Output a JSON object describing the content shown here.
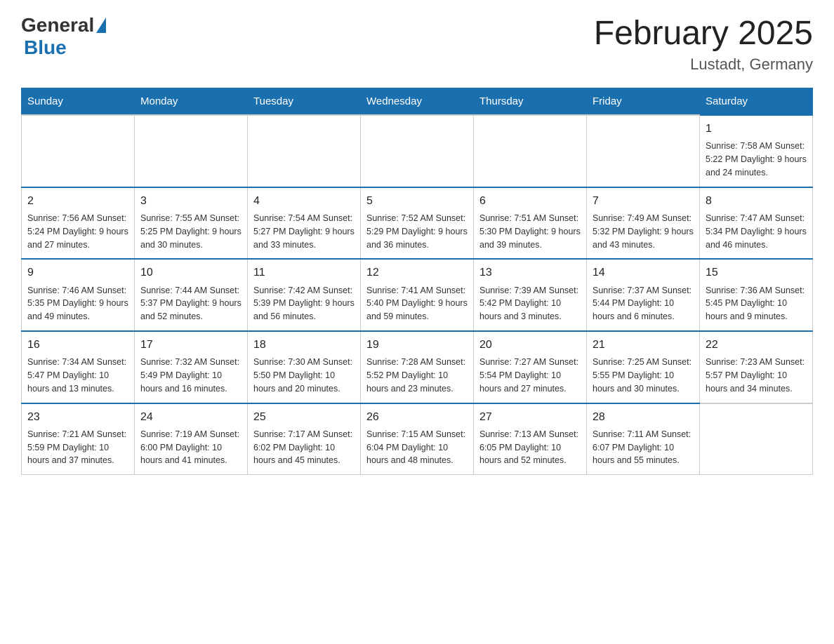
{
  "header": {
    "logo_general": "General",
    "logo_blue": "Blue",
    "title": "February 2025",
    "subtitle": "Lustadt, Germany"
  },
  "weekdays": [
    "Sunday",
    "Monday",
    "Tuesday",
    "Wednesday",
    "Thursday",
    "Friday",
    "Saturday"
  ],
  "weeks": [
    [
      {
        "day": "",
        "info": ""
      },
      {
        "day": "",
        "info": ""
      },
      {
        "day": "",
        "info": ""
      },
      {
        "day": "",
        "info": ""
      },
      {
        "day": "",
        "info": ""
      },
      {
        "day": "",
        "info": ""
      },
      {
        "day": "1",
        "info": "Sunrise: 7:58 AM\nSunset: 5:22 PM\nDaylight: 9 hours and 24 minutes."
      }
    ],
    [
      {
        "day": "2",
        "info": "Sunrise: 7:56 AM\nSunset: 5:24 PM\nDaylight: 9 hours and 27 minutes."
      },
      {
        "day": "3",
        "info": "Sunrise: 7:55 AM\nSunset: 5:25 PM\nDaylight: 9 hours and 30 minutes."
      },
      {
        "day": "4",
        "info": "Sunrise: 7:54 AM\nSunset: 5:27 PM\nDaylight: 9 hours and 33 minutes."
      },
      {
        "day": "5",
        "info": "Sunrise: 7:52 AM\nSunset: 5:29 PM\nDaylight: 9 hours and 36 minutes."
      },
      {
        "day": "6",
        "info": "Sunrise: 7:51 AM\nSunset: 5:30 PM\nDaylight: 9 hours and 39 minutes."
      },
      {
        "day": "7",
        "info": "Sunrise: 7:49 AM\nSunset: 5:32 PM\nDaylight: 9 hours and 43 minutes."
      },
      {
        "day": "8",
        "info": "Sunrise: 7:47 AM\nSunset: 5:34 PM\nDaylight: 9 hours and 46 minutes."
      }
    ],
    [
      {
        "day": "9",
        "info": "Sunrise: 7:46 AM\nSunset: 5:35 PM\nDaylight: 9 hours and 49 minutes."
      },
      {
        "day": "10",
        "info": "Sunrise: 7:44 AM\nSunset: 5:37 PM\nDaylight: 9 hours and 52 minutes."
      },
      {
        "day": "11",
        "info": "Sunrise: 7:42 AM\nSunset: 5:39 PM\nDaylight: 9 hours and 56 minutes."
      },
      {
        "day": "12",
        "info": "Sunrise: 7:41 AM\nSunset: 5:40 PM\nDaylight: 9 hours and 59 minutes."
      },
      {
        "day": "13",
        "info": "Sunrise: 7:39 AM\nSunset: 5:42 PM\nDaylight: 10 hours and 3 minutes."
      },
      {
        "day": "14",
        "info": "Sunrise: 7:37 AM\nSunset: 5:44 PM\nDaylight: 10 hours and 6 minutes."
      },
      {
        "day": "15",
        "info": "Sunrise: 7:36 AM\nSunset: 5:45 PM\nDaylight: 10 hours and 9 minutes."
      }
    ],
    [
      {
        "day": "16",
        "info": "Sunrise: 7:34 AM\nSunset: 5:47 PM\nDaylight: 10 hours and 13 minutes."
      },
      {
        "day": "17",
        "info": "Sunrise: 7:32 AM\nSunset: 5:49 PM\nDaylight: 10 hours and 16 minutes."
      },
      {
        "day": "18",
        "info": "Sunrise: 7:30 AM\nSunset: 5:50 PM\nDaylight: 10 hours and 20 minutes."
      },
      {
        "day": "19",
        "info": "Sunrise: 7:28 AM\nSunset: 5:52 PM\nDaylight: 10 hours and 23 minutes."
      },
      {
        "day": "20",
        "info": "Sunrise: 7:27 AM\nSunset: 5:54 PM\nDaylight: 10 hours and 27 minutes."
      },
      {
        "day": "21",
        "info": "Sunrise: 7:25 AM\nSunset: 5:55 PM\nDaylight: 10 hours and 30 minutes."
      },
      {
        "day": "22",
        "info": "Sunrise: 7:23 AM\nSunset: 5:57 PM\nDaylight: 10 hours and 34 minutes."
      }
    ],
    [
      {
        "day": "23",
        "info": "Sunrise: 7:21 AM\nSunset: 5:59 PM\nDaylight: 10 hours and 37 minutes."
      },
      {
        "day": "24",
        "info": "Sunrise: 7:19 AM\nSunset: 6:00 PM\nDaylight: 10 hours and 41 minutes."
      },
      {
        "day": "25",
        "info": "Sunrise: 7:17 AM\nSunset: 6:02 PM\nDaylight: 10 hours and 45 minutes."
      },
      {
        "day": "26",
        "info": "Sunrise: 7:15 AM\nSunset: 6:04 PM\nDaylight: 10 hours and 48 minutes."
      },
      {
        "day": "27",
        "info": "Sunrise: 7:13 AM\nSunset: 6:05 PM\nDaylight: 10 hours and 52 minutes."
      },
      {
        "day": "28",
        "info": "Sunrise: 7:11 AM\nSunset: 6:07 PM\nDaylight: 10 hours and 55 minutes."
      },
      {
        "day": "",
        "info": ""
      }
    ]
  ]
}
